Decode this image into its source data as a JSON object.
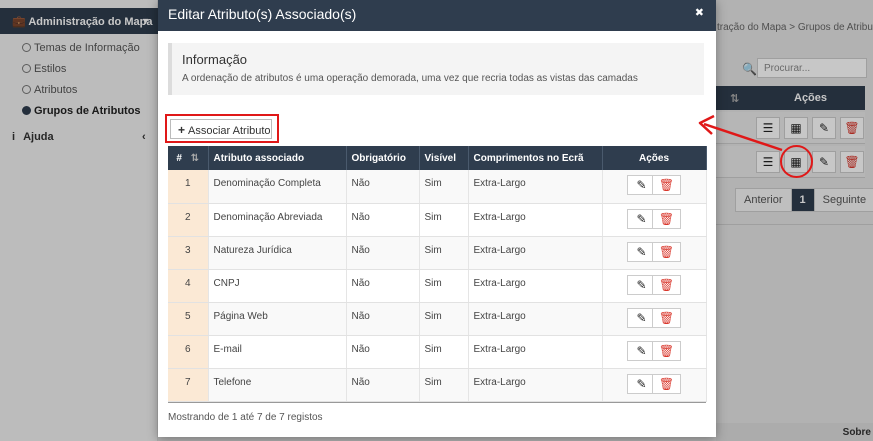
{
  "sidebar": {
    "section_title": "Administração do Mapa",
    "items": [
      {
        "label": "Temas de Informação",
        "active": false
      },
      {
        "label": "Estilos",
        "active": false
      },
      {
        "label": "Atributos",
        "active": false
      },
      {
        "label": "Grupos de Atributos",
        "active": true
      }
    ],
    "help_label": "Ajuda"
  },
  "background": {
    "breadcrumb": "tração do Mapa  >  Grupos de Atributos",
    "search_placeholder": "Procurar...",
    "actions_header": "Ações",
    "pager": {
      "prev": "Anterior",
      "current": "1",
      "next": "Seguinte"
    },
    "footer_text": "Sobre"
  },
  "modal": {
    "title": "Editar Atributo(s) Associado(s)",
    "info_title": "Informação",
    "info_text": "A ordenação de atributos é uma operação demorada, uma vez que recria todas as vistas das camadas",
    "associate_button": "Associar Atributo",
    "columns": [
      "#",
      "Atributo associado",
      "Obrigatório",
      "Visível",
      "Comprimentos no Ecrã",
      "Ações"
    ],
    "rows": [
      {
        "n": "1",
        "attr": "Denominação Completa",
        "req": "Não",
        "vis": "Sim",
        "len": "Extra-Largo"
      },
      {
        "n": "2",
        "attr": "Denominação Abreviada",
        "req": "Não",
        "vis": "Sim",
        "len": "Extra-Largo"
      },
      {
        "n": "3",
        "attr": "Natureza Jurídica",
        "req": "Não",
        "vis": "Sim",
        "len": "Extra-Largo"
      },
      {
        "n": "4",
        "attr": "CNPJ",
        "req": "Não",
        "vis": "Sim",
        "len": "Extra-Largo"
      },
      {
        "n": "5",
        "attr": "Página Web",
        "req": "Não",
        "vis": "Sim",
        "len": "Extra-Largo"
      },
      {
        "n": "6",
        "attr": "E-mail",
        "req": "Não",
        "vis": "Sim",
        "len": "Extra-Largo"
      },
      {
        "n": "7",
        "attr": "Telefone",
        "req": "Não",
        "vis": "Sim",
        "len": "Extra-Largo"
      }
    ],
    "footer": "Mostrando de 1 até 7 de 7 registos"
  },
  "colors": {
    "header": "#2f3d4e",
    "annotation": "#e01818",
    "delete": "#d9362b",
    "row_number_bg": "#fbe9d5"
  },
  "icons": [
    "briefcase-icon",
    "radio-icon",
    "info-icon",
    "close-icon",
    "plus-icon",
    "sort-icon",
    "pencil-icon",
    "trash-icon",
    "list-icon",
    "search-icon"
  ]
}
